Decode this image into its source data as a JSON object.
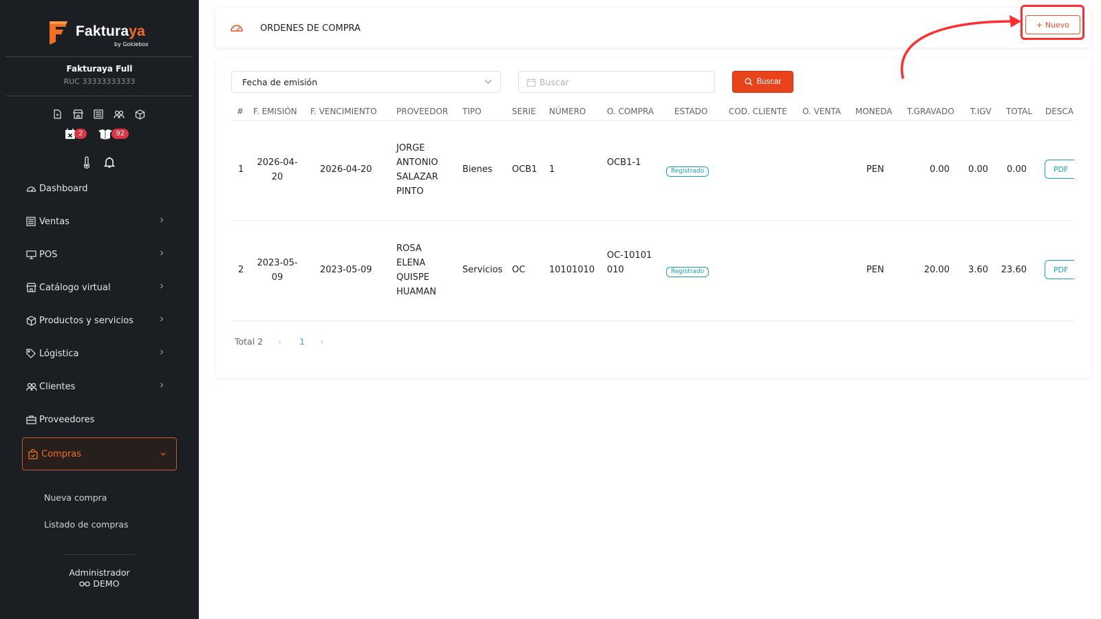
{
  "sidebar": {
    "brand_main": "Faktura",
    "brand_accent": "ya",
    "brand_sub": "by Gokiebox",
    "company_name": "Fakturaya Full",
    "company_ruc": "RUC 33333333333",
    "quick_icons": [
      "document-icon",
      "store-icon",
      "list-icon",
      "users-icon",
      "box-icon"
    ],
    "badges": [
      {
        "icon": "calendar-x-icon",
        "count": "2"
      },
      {
        "icon": "boxes-icon",
        "count": "92"
      }
    ],
    "menu": [
      {
        "label": "Dashboard",
        "icon": "gauge-icon",
        "has_children": false
      },
      {
        "label": "Ventas",
        "icon": "receipt-icon",
        "has_children": true
      },
      {
        "label": "POS",
        "icon": "monitor-icon",
        "has_children": true
      },
      {
        "label": "Catálogo virtual",
        "icon": "store-icon",
        "has_children": true
      },
      {
        "label": "Productos y servicios",
        "icon": "box-icon",
        "has_children": true
      },
      {
        "label": "Lógistica",
        "icon": "tag-icon",
        "has_children": true
      },
      {
        "label": "Clientes",
        "icon": "users-icon",
        "has_children": true
      },
      {
        "label": "Proveedores",
        "icon": "briefcase-icon",
        "has_children": false
      },
      {
        "label": "Compras",
        "icon": "shopping-bag-icon",
        "has_children": true,
        "active": true
      }
    ],
    "submenu": [
      "Nueva compra",
      "Listado de compras"
    ],
    "user_role": "Administrador",
    "user_name": "DEMO"
  },
  "header": {
    "title": "ORDENES DE COMPRA",
    "new_button": "+ Nuevo"
  },
  "filters": {
    "select_value": "Fecha de emisión",
    "search_placeholder": "Buscar",
    "search_button": "Buscar"
  },
  "table": {
    "columns": [
      "#",
      "F. EMISIÓN",
      "F. VENCIMIENTO",
      "PROVEEDOR",
      "TIPO",
      "SERIE",
      "NÚMERO",
      "O. COMPRA",
      "ESTADO",
      "COD. CLIENTE",
      "O. VENTA",
      "MONEDA",
      "T.GRAVADO",
      "T.IGV",
      "TOTAL",
      "DESCA"
    ],
    "rows": [
      {
        "index": "1",
        "emision": "2026-04-20",
        "vencimiento": "2026-04-20",
        "proveedor": "JORGE ANTONIO SALAZAR PINTO",
        "tipo": "Bienes",
        "serie": "OCB1",
        "numero": "1",
        "orden_compra": "OCB1-1",
        "estado": "Registrado",
        "cod_cliente": "",
        "orden_venta": "",
        "moneda": "PEN",
        "t_gravado": "0.00",
        "t_igv": "0.00",
        "total": "0.00",
        "descarga": "PDF"
      },
      {
        "index": "2",
        "emision": "2023-05-09",
        "vencimiento": "2023-05-09",
        "proveedor": "ROSA ELENA QUISPE HUAMAN",
        "tipo": "Servicios",
        "serie": "OC",
        "numero": "10101010",
        "orden_compra": "OC-10101010",
        "estado": "Registrado",
        "cod_cliente": "",
        "orden_venta": "",
        "moneda": "PEN",
        "t_gravado": "20.00",
        "t_igv": "3.60",
        "total": "23.60",
        "descarga": "PDF"
      }
    ]
  },
  "pagination": {
    "total": "Total 2",
    "current_page": "1"
  },
  "colors": {
    "accent": "#e9431b",
    "sidebar_bg": "#1b1e23",
    "status": "#17a2b8",
    "annotation": "#ff2d2d"
  }
}
